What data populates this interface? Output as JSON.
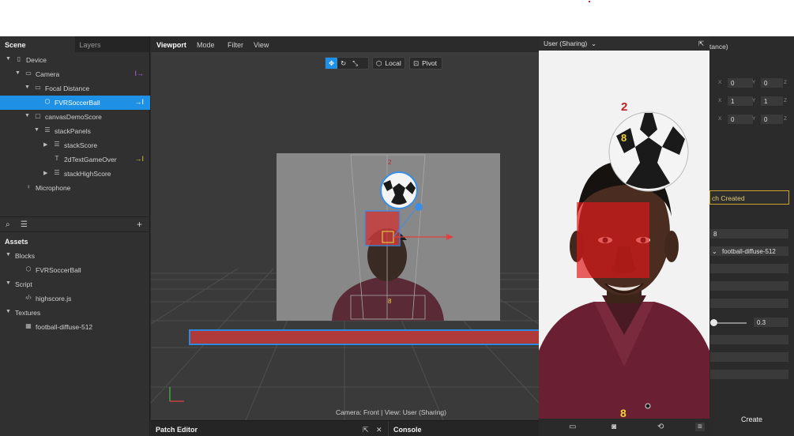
{
  "left_panel": {
    "tabs": [
      "Scene",
      "Layers"
    ],
    "scene_tree": [
      {
        "label": "Device",
        "icon": "device-icon",
        "level": 0,
        "caret": "▼"
      },
      {
        "label": "Camera",
        "icon": "camera-icon",
        "level": 1,
        "caret": "▼",
        "right": "I→"
      },
      {
        "label": "Focal Distance",
        "icon": "focal-icon",
        "level": 2,
        "caret": "▼"
      },
      {
        "label": "FVRSoccerBall",
        "icon": "cube-icon",
        "level": 3,
        "caret": "",
        "right": "→I",
        "selected": true
      },
      {
        "label": "canvasDemoScore",
        "icon": "canvas-icon",
        "level": 2,
        "caret": "▼"
      },
      {
        "label": "stackPanels",
        "icon": "stack-icon",
        "level": 3,
        "caret": "▼"
      },
      {
        "label": "stackScore",
        "icon": "stack-icon",
        "level": 4,
        "caret": "▶"
      },
      {
        "label": "2dTextGameOver",
        "icon": "text-icon",
        "level": 4,
        "caret": "",
        "right": "→I"
      },
      {
        "label": "stackHighScore",
        "icon": "stack-icon",
        "level": 4,
        "caret": "▶"
      },
      {
        "label": "Microphone",
        "icon": "microphone-icon",
        "level": 1,
        "caret": ""
      }
    ],
    "assets_title": "Assets",
    "assets_tree": [
      {
        "label": "Blocks",
        "icon": "",
        "level": 0,
        "caret": "▼"
      },
      {
        "label": "FVRSoccerBall",
        "icon": "cube-icon",
        "level": 1,
        "caret": ""
      },
      {
        "label": "Script",
        "icon": "",
        "level": 0,
        "caret": "▼"
      },
      {
        "label": "highscore.js",
        "icon": "script-icon",
        "level": 1,
        "caret": ""
      },
      {
        "label": "Textures",
        "icon": "",
        "level": 0,
        "caret": "▼"
      },
      {
        "label": "football-diffuse-512",
        "icon": "texture-icon",
        "level": 1,
        "caret": ""
      }
    ]
  },
  "viewport": {
    "menu": [
      "Viewport",
      "Mode",
      "Filter",
      "View"
    ],
    "tools_local": "Local",
    "tools_pivot": "Pivot",
    "score_top": "2",
    "score_bottom": "8",
    "status": "Camera: Front | View: User (Sharing)"
  },
  "bottom": {
    "patch_editor": "Patch Editor",
    "console": "Console"
  },
  "preview": {
    "title": "User (Sharing)",
    "score_top": "2",
    "ball_number": "8",
    "score_bottom": "8"
  },
  "inspector": {
    "title_fragment": "tance)",
    "rows": [
      {
        "x": "0",
        "y": "0"
      },
      {
        "x": "1",
        "y": "1"
      },
      {
        "x": "0",
        "y": "0"
      }
    ],
    "patch_created": "ch Created",
    "field_8": "8",
    "texture": "football-diffuse-512",
    "slider_value": "0.3",
    "create": "Create"
  },
  "colors": {
    "selection": "#1e90e6",
    "accent_yellow": "#c9a227",
    "score_red": "#c02020",
    "score_yellow": "#f2d43a"
  }
}
